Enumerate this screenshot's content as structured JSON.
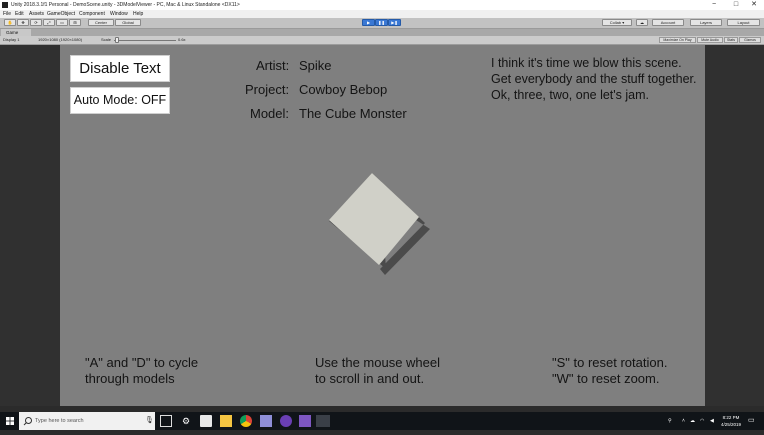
{
  "window": {
    "title": "Unity 2018.3.1f1 Personal - DemoScene.unity - 3DModelViewer - PC, Mac & Linux Standalone <DX11>",
    "controls": [
      "−",
      "□",
      "✕"
    ]
  },
  "menu": [
    "File",
    "Edit",
    "Assets",
    "GameObject",
    "Component",
    "Window",
    "Help"
  ],
  "toolbar": {
    "pivot": "Center",
    "space": "Global",
    "collab": "Collab ▾",
    "account": "Account",
    "layers": "Layers",
    "layout": "Layout"
  },
  "game_tab": {
    "label": "Game",
    "display": "Display 1",
    "resolution": "1920×1080 (1920×1080)",
    "scale_label": "Scale",
    "scale_value": "0.6x",
    "maximize": "Maximize On Play",
    "mute": "Mute Audio",
    "stats": "Stats",
    "gizmos": "Gizmos"
  },
  "game": {
    "disable_text_button": "Disable Text",
    "auto_mode_button": "Auto Mode: OFF",
    "artist_label": "Artist:",
    "artist_value": "Spike",
    "project_label": "Project:",
    "project_value": "Cowboy Bebop",
    "model_label": "Model:",
    "model_value": "The Cube Monster",
    "quote": "I think it's time we blow this scene. Get everybody and the stuff together. Ok, three, two, one let's jam.",
    "hint_cycle_1": "\"A\" and \"D\" to cycle",
    "hint_cycle_2": "through models",
    "hint_scroll_1": "Use the mouse wheel",
    "hint_scroll_2": "to scroll in and out.",
    "hint_reset_1": "\"S\" to reset rotation.",
    "hint_reset_2": "\"W\" to reset zoom."
  },
  "taskbar": {
    "search_placeholder": "Type here to search",
    "time": "8:22 PM",
    "date": "4/25/2019"
  },
  "colors": {
    "viewport": "#7f7f7f",
    "cube_face": "#d0d0c8",
    "cube_shadow": "#4b4b4b",
    "play_blue": "#3a78d4"
  }
}
